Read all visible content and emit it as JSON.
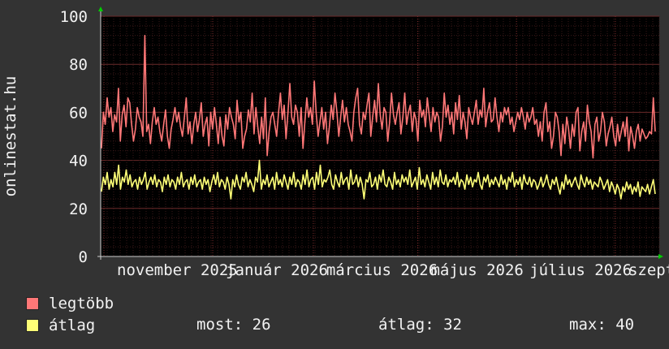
{
  "chart_data": {
    "type": "line",
    "ylabel": "onlinestat.hu",
    "ylim": [
      0,
      100
    ],
    "yticks": [
      0,
      20,
      40,
      60,
      80,
      100
    ],
    "xtick_labels": [
      "november 2025",
      "január 2026",
      "március 2026",
      "május 2026",
      "július 2026",
      "szeptember"
    ],
    "xtick_pos": [
      0.0,
      0.196,
      0.377,
      0.565,
      0.743,
      0.921
    ],
    "x_start": 0,
    "colors": {
      "max": "#ff7777",
      "avg": "#ffff77",
      "background": "#000000",
      "grid": "#4a1f1f"
    },
    "series": [
      {
        "name": "legtöbb",
        "color": "#ff7777",
        "values": [
          45,
          60,
          55,
          66,
          58,
          62,
          52,
          59,
          56,
          70,
          48,
          59,
          63,
          54,
          66,
          64,
          55,
          48,
          53,
          62,
          58,
          56,
          50,
          92,
          52,
          55,
          47,
          56,
          62,
          55,
          58,
          52,
          48,
          55,
          61,
          50,
          45,
          53,
          57,
          62,
          56,
          60,
          54,
          50,
          58,
          66,
          51,
          56,
          47,
          55,
          60,
          52,
          57,
          64,
          50,
          55,
          58,
          46,
          60,
          53,
          62,
          55,
          47,
          58,
          50,
          46,
          59,
          53,
          62,
          58,
          55,
          49,
          65,
          56,
          60,
          45,
          50,
          53,
          61,
          56,
          68,
          51,
          62,
          54,
          47,
          58,
          49,
          66,
          42,
          52,
          58,
          60,
          55,
          50,
          60,
          68,
          57,
          63,
          49,
          60,
          72,
          58,
          55,
          63,
          60,
          50,
          62,
          45,
          56,
          66,
          58,
          62,
          55,
          73,
          60,
          50,
          56,
          62,
          53,
          60,
          47,
          54,
          63,
          57,
          68,
          60,
          50,
          58,
          65,
          56,
          62,
          55,
          52,
          48,
          60,
          66,
          70,
          55,
          51,
          60,
          57,
          63,
          68,
          50,
          58,
          65,
          56,
          72,
          59,
          53,
          62,
          60,
          48,
          56,
          68,
          59,
          55,
          60,
          64,
          51,
          58,
          68,
          55,
          60,
          63,
          52,
          60,
          57,
          48,
          65,
          58,
          61,
          54,
          66,
          59,
          52,
          62,
          56,
          60,
          58,
          48,
          54,
          68,
          58,
          63,
          55,
          60,
          51,
          64,
          57,
          67,
          53,
          60,
          56,
          49,
          62,
          58,
          55,
          60,
          65,
          55,
          61,
          58,
          70,
          54,
          60,
          64,
          56,
          57,
          66,
          58,
          52,
          60,
          56,
          62,
          59,
          62,
          55,
          58,
          52,
          56,
          60,
          57,
          62,
          58,
          53,
          60,
          56,
          58,
          62,
          55,
          57,
          50,
          56,
          48,
          60,
          64,
          52,
          56,
          45,
          50,
          60,
          58,
          52,
          42,
          55,
          47,
          58,
          53,
          45,
          55,
          50,
          60,
          62,
          44,
          52,
          56,
          48,
          63,
          56,
          52,
          41,
          55,
          58,
          48,
          52,
          60,
          56,
          46,
          51,
          54,
          58,
          50,
          46,
          55,
          48,
          52,
          56,
          50,
          58,
          44,
          54,
          50,
          45,
          52,
          55,
          48,
          53,
          51,
          49,
          50,
          52,
          51,
          66,
          52
        ]
      },
      {
        "name": "átlag",
        "color": "#ffff77",
        "values": [
          27,
          33,
          30,
          35,
          28,
          32,
          29,
          35,
          30,
          38,
          28,
          33,
          31,
          36,
          30,
          34,
          29,
          31,
          32,
          28,
          33,
          30,
          32,
          35,
          28,
          31,
          33,
          30,
          34,
          29,
          32,
          31,
          27,
          33,
          30,
          34,
          29,
          32,
          31,
          28,
          33,
          30,
          35,
          29,
          31,
          32,
          28,
          33,
          30,
          34,
          29,
          31,
          32,
          28,
          33,
          30,
          32,
          27,
          31,
          34,
          30,
          35,
          29,
          32,
          31,
          28,
          33,
          30,
          24,
          32,
          29,
          34,
          30,
          28,
          33,
          31,
          35,
          29,
          32,
          30,
          27,
          33,
          31,
          40,
          28,
          32,
          30,
          34,
          29,
          31,
          33,
          28,
          35,
          30,
          32,
          29,
          34,
          31,
          28,
          33,
          30,
          35,
          29,
          32,
          31,
          28,
          34,
          30,
          36,
          29,
          32,
          33,
          28,
          35,
          30,
          38,
          29,
          32,
          31,
          33,
          36,
          30,
          28,
          34,
          31,
          29,
          35,
          30,
          32,
          33,
          28,
          36,
          30,
          31,
          34,
          29,
          33,
          30,
          24,
          32,
          31,
          35,
          29,
          30,
          33,
          28,
          34,
          31,
          36,
          30,
          29,
          33,
          31,
          28,
          35,
          30,
          32,
          29,
          34,
          31,
          33,
          30,
          36,
          29,
          31,
          33,
          28,
          37,
          30,
          32,
          29,
          34,
          31,
          28,
          35,
          30,
          33,
          29,
          36,
          31,
          30,
          34,
          29,
          32,
          31,
          33,
          30,
          35,
          29,
          32,
          31,
          28,
          34,
          30,
          33,
          29,
          32,
          31,
          35,
          30,
          28,
          33,
          31,
          34,
          29,
          32,
          30,
          33,
          31,
          29,
          34,
          30,
          32,
          28,
          33,
          31,
          35,
          29,
          32,
          30,
          33,
          28,
          34,
          31,
          30,
          33,
          29,
          32,
          31,
          28,
          30,
          33,
          29,
          31,
          34,
          30,
          28,
          32,
          30,
          33,
          29,
          26,
          31,
          28,
          34,
          30,
          32,
          29,
          31,
          33,
          30,
          28,
          34,
          31,
          29,
          33,
          30,
          32,
          28,
          31,
          30,
          29,
          33,
          31,
          28,
          30,
          32,
          27,
          31,
          29,
          26,
          30,
          28,
          24,
          29,
          27,
          31,
          28,
          30,
          26,
          29,
          27,
          31,
          25,
          29,
          28,
          27,
          30,
          26,
          29,
          32,
          26
        ]
      }
    ]
  },
  "legend": [
    {
      "label": "legtöbb",
      "color": "#ff7777"
    },
    {
      "label": "átlag",
      "color": "#ffff77"
    }
  ],
  "stats": {
    "most": "most: 26",
    "atlag": "átlag: 32",
    "max": "max: 40"
  }
}
